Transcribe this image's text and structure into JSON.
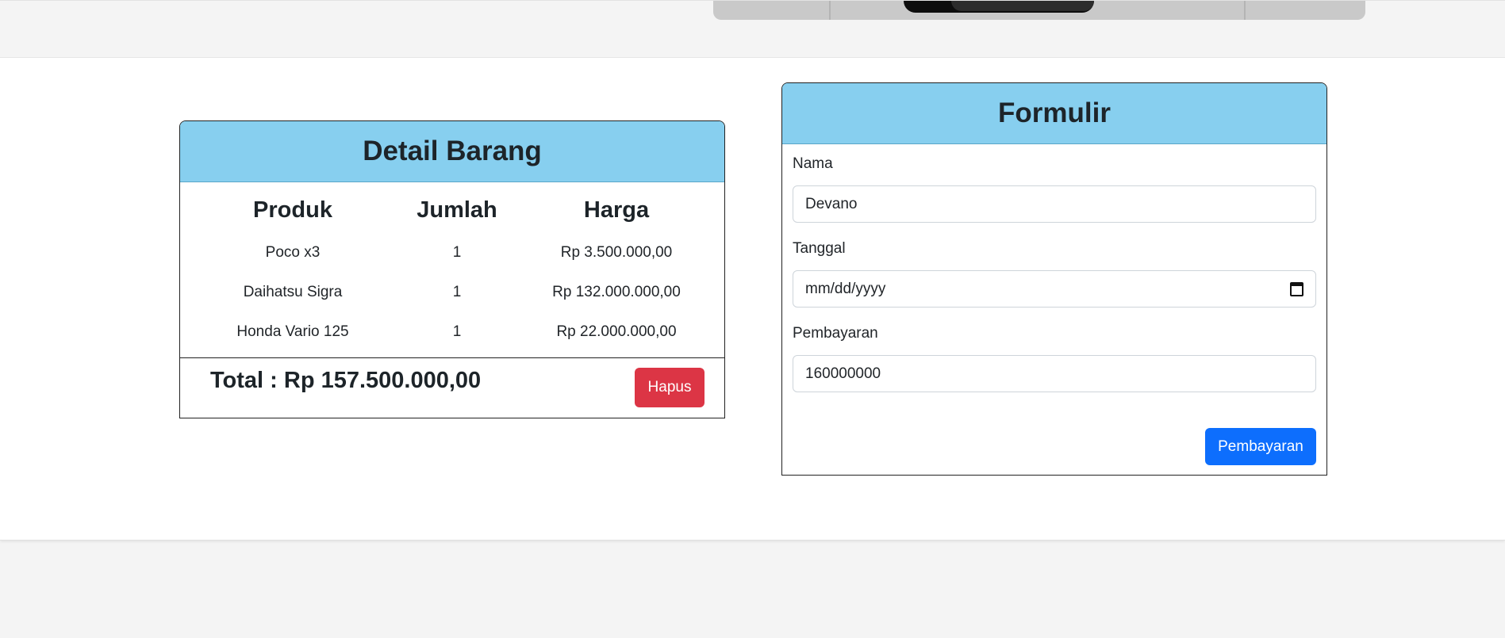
{
  "detail": {
    "title": "Detail Barang",
    "columns": [
      "Produk",
      "Jumlah",
      "Harga"
    ],
    "rows": [
      {
        "produk": "Poco x3",
        "jumlah": "1",
        "harga": "Rp 3.500.000,00"
      },
      {
        "produk": "Daihatsu Sigra",
        "jumlah": "1",
        "harga": "Rp 132.000.000,00"
      },
      {
        "produk": "Honda Vario 125",
        "jumlah": "1",
        "harga": "Rp 22.000.000,00"
      }
    ],
    "total": "Total : Rp 157.500.000,00",
    "delete_label": "Hapus"
  },
  "form": {
    "title": "Formulir",
    "nama_label": "Nama",
    "nama_value": "Devano",
    "tanggal_label": "Tanggal",
    "tanggal_placeholder": "mm/dd/yyyy",
    "pembayaran_label": "Pembayaran",
    "pembayaran_value": "160000000",
    "submit_label": "Pembayaran"
  },
  "colors": {
    "card_header": "#87cfef",
    "danger": "#dc3545",
    "primary": "#0d6efd"
  }
}
